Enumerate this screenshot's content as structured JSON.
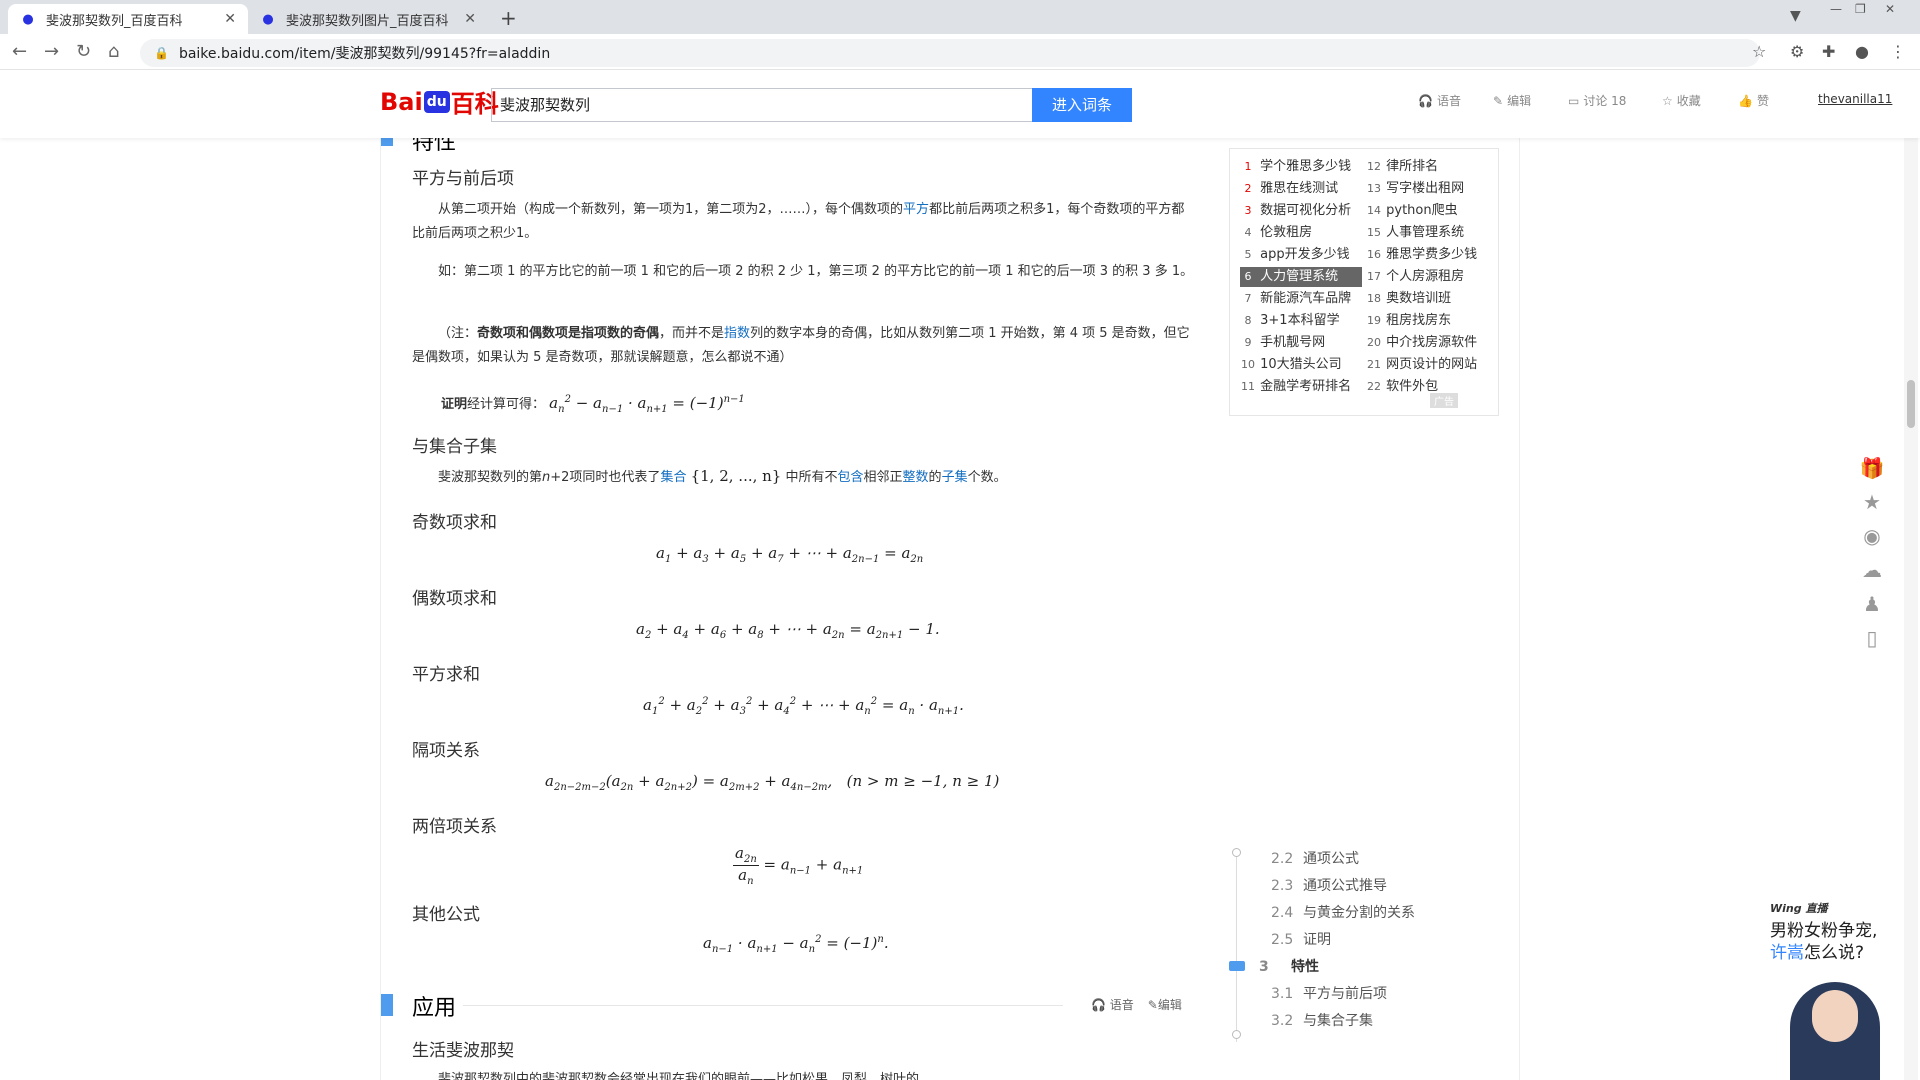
{
  "browser": {
    "tabs": [
      {
        "title": "斐波那契数列_百度百科",
        "active": true
      },
      {
        "title": "斐波那契数列图片_百度百科",
        "active": false
      }
    ],
    "new_tab": "+",
    "url": "baike.baidu.com/item/斐波那契数列/99145?fr=aladdin"
  },
  "header": {
    "logo_bai": "Bai",
    "logo_du": "du",
    "logo_ke": "百科",
    "search_value": "斐波那契数列",
    "search_button": "进入词条",
    "actions": {
      "voice": "语音",
      "edit": "编辑",
      "discuss": "讨论 18",
      "collect": "收藏",
      "like": "赞"
    },
    "user": "thevanilla11"
  },
  "main": {
    "top_section_title": "特性",
    "top_section_actions": {
      "voice": "语音",
      "edit": "编辑"
    },
    "sub1_title": "平方与前后项",
    "p1_a": "从第二项开始（构成一个新数列，第一项为1，第二项为2，……），每个偶数项的",
    "p1_link": "平方",
    "p1_b": "都比前后两项之积多1，每个奇数项的平方都比前后两项之积少1。",
    "p2": "如：第二项 1 的平方比它的前一项 1 和它的后一项 2 的积 2 少 1，第三项 2 的平方比它的前一项 1 和它的后一项 3 的积 3 多 1。",
    "p3_a": "（注：",
    "p3_bold": "奇数项和偶数项是指项数的奇偶",
    "p3_b": "，而并不是",
    "p3_link": "指数",
    "p3_c": "列的数字本身的奇偶，比如从数列第二项 1 开始数，第 4 项 5 是奇数，但它是偶数项，如果认为 5 是奇数项，那就误解题意，怎么都说不通）",
    "proof_label": "证明",
    "proof_text": "经计算可得：",
    "sub2_title": "与集合子集",
    "p4_a": "斐波那契数列的第",
    "p4_var": "n",
    "p4_b": "+2项同时也代表了",
    "p4_link1": "集合",
    "p4_set": "{1, 2, ..., n}",
    "p4_c": "中所有不",
    "p4_link2": "包含",
    "p4_d": "相邻正",
    "p4_link3": "整数",
    "p4_e": "的",
    "p4_link4": "子集",
    "p4_f": "个数。",
    "sub3_title": "奇数项求和",
    "sub4_title": "偶数项求和",
    "sub5_title": "平方求和",
    "sub6_title": "隔项关系",
    "sub7_title": "两倍项关系",
    "sub8_title": "其他公式",
    "app_section_title": "应用",
    "app_section_actions": {
      "voice": "语音",
      "edit": "编辑"
    },
    "sub9_title": "生活斐波那契",
    "p5_partial": "斐波那契数列中的斐波那契数会经常出现在我们的眼前——比如松果、凤梨、树叶的"
  },
  "ad": {
    "left": [
      {
        "n": "1",
        "t": "学个雅思多少钱"
      },
      {
        "n": "2",
        "t": "雅思在线测试"
      },
      {
        "n": "3",
        "t": "数据可视化分析"
      },
      {
        "n": "4",
        "t": "伦敦租房"
      },
      {
        "n": "5",
        "t": "app开发多少钱"
      },
      {
        "n": "6",
        "t": "人力管理系统"
      },
      {
        "n": "7",
        "t": "新能源汽车品牌"
      },
      {
        "n": "8",
        "t": "3+1本科留学"
      },
      {
        "n": "9",
        "t": "手机靓号网"
      },
      {
        "n": "10",
        "t": "10大猎头公司"
      },
      {
        "n": "11",
        "t": "金融学考研排名"
      }
    ],
    "right": [
      {
        "n": "12",
        "t": "律所排名"
      },
      {
        "n": "13",
        "t": "写字楼出租网"
      },
      {
        "n": "14",
        "t": "python爬虫"
      },
      {
        "n": "15",
        "t": "人事管理系统"
      },
      {
        "n": "16",
        "t": "雅思学费多少钱"
      },
      {
        "n": "17",
        "t": "个人房源租房"
      },
      {
        "n": "18",
        "t": "奥数培训班"
      },
      {
        "n": "19",
        "t": "租房找房东"
      },
      {
        "n": "20",
        "t": "中介找房源软件"
      },
      {
        "n": "21",
        "t": "网页设计的网站"
      },
      {
        "n": "22",
        "t": "软件外包"
      }
    ],
    "tag": "广告"
  },
  "catalog": [
    {
      "n": "2.2",
      "t": "通项公式"
    },
    {
      "n": "2.3",
      "t": "通项公式推导"
    },
    {
      "n": "2.4",
      "t": "与黄金分割的关系"
    },
    {
      "n": "2.5",
      "t": "证明"
    },
    {
      "n": "3",
      "t": "特性"
    },
    {
      "n": "3.1",
      "t": "平方与前后项"
    },
    {
      "n": "3.2",
      "t": "与集合子集"
    }
  ],
  "promo": {
    "tag": "Wing 直播",
    "line1": "男粉女粉争宠,",
    "line2_blue": "许嵩",
    "line2": "怎么说?"
  },
  "side_icons": [
    "gift-icon",
    "star-icon",
    "weibo-icon",
    "wechat-icon",
    "qq-icon",
    "phone-icon"
  ]
}
